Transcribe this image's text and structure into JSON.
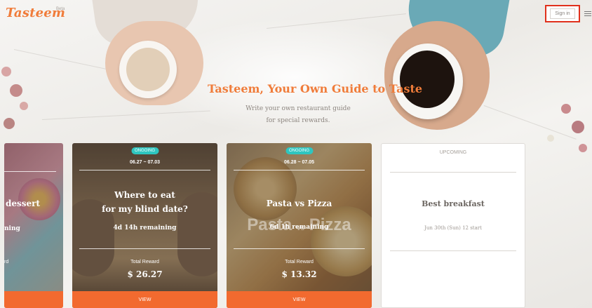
{
  "header": {
    "logo": "Tasteem",
    "beta": "Beta",
    "sign_in": "Sign in"
  },
  "hero": {
    "title": "Tasteem, Your Own Guide to Taste",
    "subtitle_line1": "Write your own restaurant guide",
    "subtitle_line2": "for special rewards."
  },
  "cards": [
    {
      "status": "",
      "dates": "",
      "title_line1": "dessert",
      "title_line2": "",
      "remaining": "ning",
      "reward_label": "rd",
      "reward": "",
      "button": ""
    },
    {
      "status": "ONGOING",
      "dates": "06.27 ~ 07.03",
      "title_line1": "Where to eat",
      "title_line2": "for my blind date?",
      "remaining": "4d 14h remaining",
      "reward_label": "Total Reward",
      "reward": "$ 26.27",
      "button": "VIEW"
    },
    {
      "status": "ONGOING",
      "dates": "06.28 ~ 07.05",
      "title_line1": "Pasta vs Pizza",
      "title_line2": "",
      "remaining": "6d 1h remaining",
      "reward_label": "Total Reward",
      "reward": "$ 13.32",
      "button": "VIEW",
      "background_text_left": "Pasta",
      "background_text_mid": "vs",
      "background_text_right": "Pizza"
    }
  ],
  "upcoming": {
    "label": "UPCOMING",
    "title": "Best breakfast",
    "start": "Jun 30th (Sun) 12 start"
  },
  "colors": {
    "brand": "#f07c3a",
    "button": "#f26a2f",
    "ongoing": "#2ec6c0",
    "highlight": "#e0301c"
  },
  "icons": [
    "menu-icon"
  ]
}
